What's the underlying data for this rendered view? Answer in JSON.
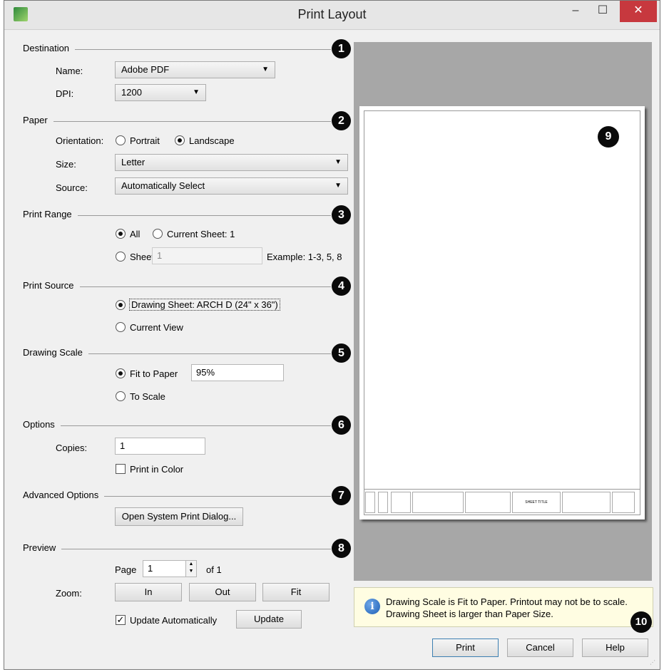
{
  "window": {
    "title": "Print Layout",
    "minimize_icon": "minimize-icon",
    "maximize_icon": "maximize-icon",
    "close_icon": "close-icon",
    "close_glyph": "✕",
    "min_glyph": "–",
    "max_glyph": "☐"
  },
  "sections": [
    {
      "label": "Destination",
      "badge": "1"
    },
    {
      "label": "Paper",
      "badge": "2"
    },
    {
      "label": "Print Range",
      "badge": "3"
    },
    {
      "label": "Print Source",
      "badge": "4"
    },
    {
      "label": "Drawing Scale",
      "badge": "5"
    },
    {
      "label": "Options",
      "badge": "6"
    },
    {
      "label": "Advanced Options",
      "badge": "7"
    },
    {
      "label": "Preview",
      "badge": "8"
    }
  ],
  "destination": {
    "name_label": "Name:",
    "name_value": "Adobe PDF",
    "dpi_label": "DPI:",
    "dpi_value": "1200"
  },
  "paper": {
    "orientation_label": "Orientation:",
    "portrait_label": "Portrait",
    "landscape_label": "Landscape",
    "size_label": "Size:",
    "size_value": "Letter",
    "source_label": "Source:",
    "source_value": "Automatically Select",
    "selected_orientation": "Landscape"
  },
  "print_range": {
    "all_label": "All",
    "current_label": "Current Sheet: 1",
    "sheets_label": "Sheets",
    "sheets_value": "1",
    "example": "Example: 1-3, 5, 8",
    "selected": "All"
  },
  "print_source": {
    "drawing_sheet_label": "Drawing Sheet: ARCH D  (24\" x 36\")",
    "current_view_label": "Current View",
    "selected": "Drawing Sheet"
  },
  "drawing_scale": {
    "fit_label": "Fit to Paper",
    "fit_value": "95%",
    "to_scale_label": "To Scale",
    "selected": "Fit to Paper"
  },
  "options": {
    "copies_label": "Copies:",
    "copies_value": "1",
    "print_color_label": "Print in Color",
    "print_color_checked": false
  },
  "advanced": {
    "open_dialog_label": "Open System Print Dialog..."
  },
  "preview": {
    "page_label": "Page",
    "page_value": "1",
    "of_label": "of 1",
    "zoom_label": "Zoom:",
    "zoom_in": "In",
    "zoom_out": "Out",
    "zoom_fit": "Fit",
    "update_auto_label": "Update Automatically",
    "update_auto_checked": true,
    "update_label": "Update",
    "sheet_badge": "9",
    "titleblock_text": "SHEET TITLE"
  },
  "message": {
    "line1": "Drawing Scale is Fit to Paper. Printout may not be to scale.",
    "line2": "Drawing Sheet is larger than Paper Size.",
    "badge": "10",
    "icon": "info-icon"
  },
  "buttons": {
    "print": "Print",
    "cancel": "Cancel",
    "help": "Help"
  },
  "colors": {
    "badge": "#0a0a0a",
    "close": "#c7383e",
    "preview_bg": "#a7a7a7",
    "message_bg": "#fffde2"
  }
}
